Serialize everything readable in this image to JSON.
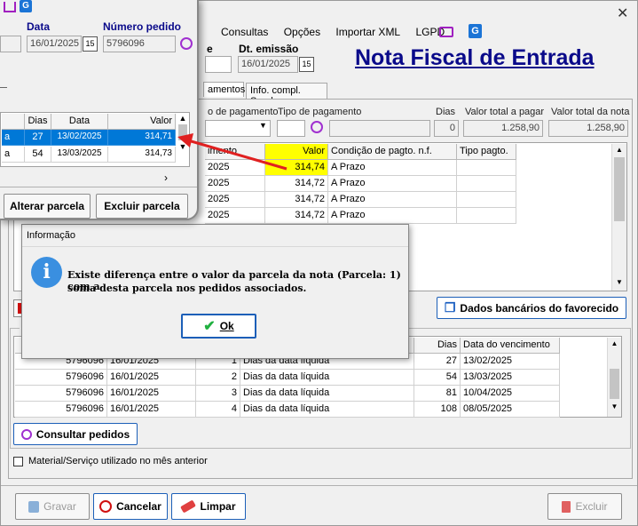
{
  "menu": {
    "items": [
      "Consultas",
      "Opções",
      "Importar XML",
      "LGPD"
    ]
  },
  "header": {
    "title": "Nota Fiscal de Entrada",
    "dt_emissao_label": "Dt. emissão",
    "dt_emissao_value": "16/01/2025",
    "e_fragment": "e"
  },
  "tabs": [
    {
      "label": "amentos"
    },
    {
      "label": "Info. compl. Sped"
    }
  ],
  "payment": {
    "cond_label": "o de pagamento",
    "tipo_label": "Tipo de pagamento",
    "dias_label": "Dias",
    "dias_value": "0",
    "valor_pagar_label": "Valor total a pagar",
    "valor_pagar_value": "1.258,90",
    "valor_nota_label": "Valor total da nota",
    "valor_nota_value": "1.258,90"
  },
  "parcelas_grid": {
    "headers": [
      "imento",
      "Valor",
      "Condição de pagto. n.f.",
      "Tipo pagto."
    ],
    "rows": [
      {
        "venc": "2025",
        "valor": "314,74",
        "cond": "A Prazo"
      },
      {
        "venc": "2025",
        "valor": "314,72",
        "cond": "A Prazo"
      },
      {
        "venc": "2025",
        "valor": "314,72",
        "cond": "A Prazo"
      },
      {
        "venc": "2025",
        "valor": "314,72",
        "cond": "A Prazo"
      }
    ]
  },
  "dados_bancarios_label": "Dados bancários do favorecido",
  "pedidos_grid": {
    "col_dias": "Dias",
    "col_venc": "Data do vencimento",
    "rows": [
      {
        "pedido": "5796096",
        "data": "16/01/2025",
        "n": "1",
        "cond": "Dias da data líquida",
        "dias": "27",
        "venc": "13/02/2025"
      },
      {
        "pedido": "5796096",
        "data": "16/01/2025",
        "n": "2",
        "cond": "Dias da data líquida",
        "dias": "54",
        "venc": "13/03/2025"
      },
      {
        "pedido": "5796096",
        "data": "16/01/2025",
        "n": "3",
        "cond": "Dias da data líquida",
        "dias": "81",
        "venc": "10/04/2025"
      },
      {
        "pedido": "5796096",
        "data": "16/01/2025",
        "n": "4",
        "cond": "Dias da data líquida",
        "dias": "108",
        "venc": "08/05/2025"
      }
    ]
  },
  "consultar_pedidos_label": "Consultar pedidos",
  "checkbox_label": "Material/Serviço utilizado no mês anterior",
  "footer": {
    "gravar": "Gravar",
    "cancelar": "Cancelar",
    "limpar": "Limpar",
    "excluir": "Excluir"
  },
  "dialog": {
    "title": "Informação",
    "message_line1": "Existe diferença entre o valor da parcela da nota (Parcela: 1) com a",
    "message_line2": "soma desta parcela nos pedidos associados.",
    "ok_label": "Ok"
  },
  "zoom": {
    "data_label": "Data",
    "data_value": "16/01/2025",
    "numero_pedido_label": "Número pedido",
    "numero_pedido_value": "5796096",
    "col_dias": "Dias",
    "col_data": "Data",
    "col_valor": "Valor",
    "rows": [
      {
        "prefix": "a",
        "dias": "27",
        "data": "13/02/2025",
        "valor": "314,71"
      },
      {
        "prefix": "a",
        "dias": "54",
        "data": "13/03/2025",
        "valor": "314,73"
      }
    ],
    "alterar_label": "Alterar parcela",
    "excluir_label": "Excluir parcela"
  },
  "colors": {
    "title_blue": "#0a0a8a",
    "selected": "#0078d7",
    "highlight": "#ffff00",
    "arrow": "#e02020"
  }
}
